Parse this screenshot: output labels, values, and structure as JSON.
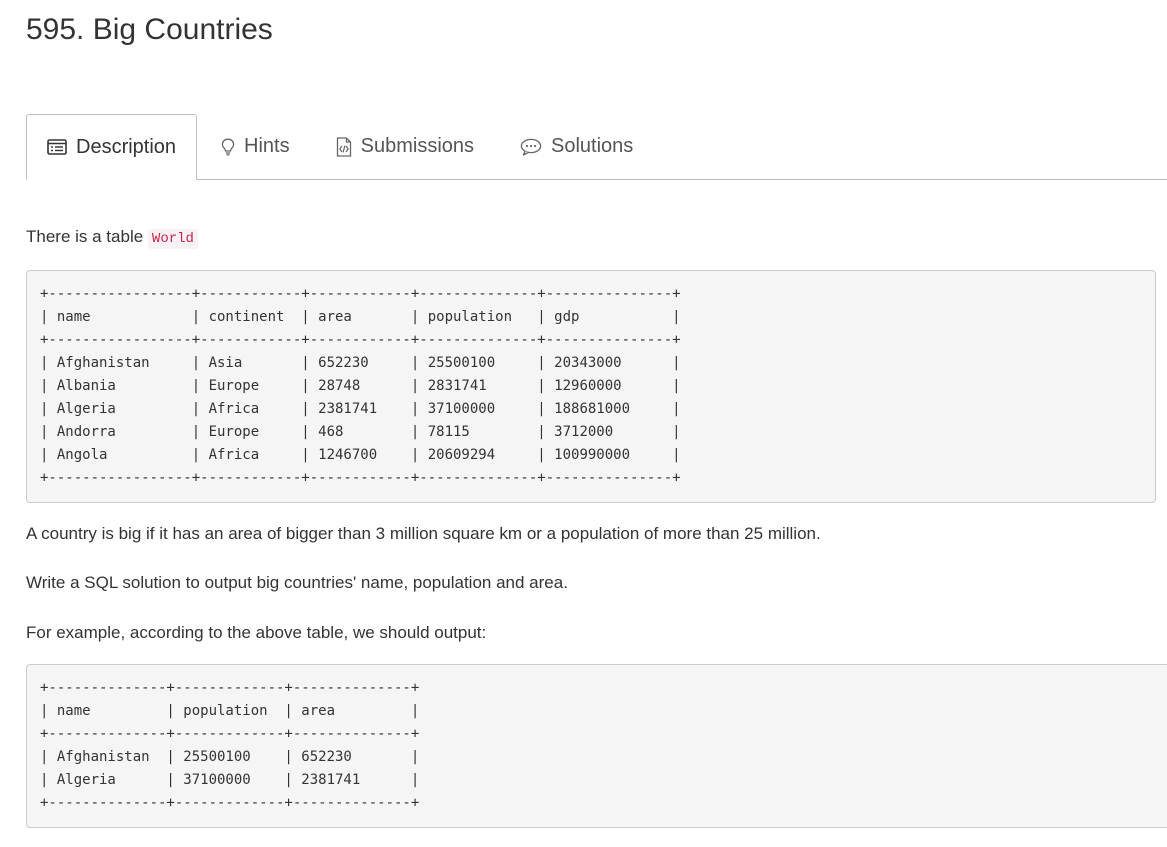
{
  "problem": {
    "title": "595. Big Countries"
  },
  "tabs": [
    {
      "label": "Description",
      "icon": "description-icon"
    },
    {
      "label": "Hints",
      "icon": "lightbulb-icon"
    },
    {
      "label": "Submissions",
      "icon": "code-file-icon"
    },
    {
      "label": "Solutions",
      "icon": "chat-bubble-icon"
    }
  ],
  "description": {
    "intro_text": "There is a table",
    "table_name": "World",
    "world_table": {
      "columns": [
        "name",
        "continent",
        "area",
        "population",
        "gdp"
      ],
      "rows": [
        [
          "Afghanistan",
          "Asia",
          "652230",
          "25500100",
          "20343000"
        ],
        [
          "Albania",
          "Europe",
          "28748",
          "2831741",
          "12960000"
        ],
        [
          "Algeria",
          "Africa",
          "2381741",
          "37100000",
          "188681000"
        ],
        [
          "Andorra",
          "Europe",
          "468",
          "78115",
          "3712000"
        ],
        [
          "Angola",
          "Africa",
          "1246700",
          "20609294",
          "100990000"
        ]
      ]
    },
    "condition_text": "A country is big if it has an area of bigger than 3 million square km or a population of more than 25 million.",
    "task_text": "Write a SQL solution to output big countries' name, population and area.",
    "example_text": "For example, according to the above table, we should output:",
    "output_table": {
      "columns": [
        "name",
        "population",
        "area"
      ],
      "rows": [
        [
          "Afghanistan",
          "25500100",
          "652230"
        ],
        [
          "Algeria",
          "37100000",
          "2381741"
        ]
      ]
    }
  }
}
